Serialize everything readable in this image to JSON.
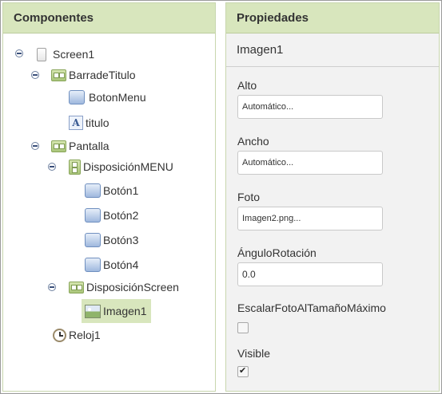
{
  "components": {
    "title": "Componentes",
    "tree": [
      {
        "label": "Screen1",
        "icon": "screen-icon"
      },
      {
        "label": "BarradeTitulo",
        "icon": "horizontal-arrangement-icon"
      },
      {
        "label": "BotonMenu",
        "icon": "button-icon"
      },
      {
        "label": "titulo",
        "icon": "label-icon"
      },
      {
        "label": "Pantalla",
        "icon": "horizontal-arrangement-icon"
      },
      {
        "label": "DisposiciónMENU",
        "icon": "vertical-arrangement-icon"
      },
      {
        "label": "Botón1",
        "icon": "button-icon"
      },
      {
        "label": "Botón2",
        "icon": "button-icon"
      },
      {
        "label": "Botón3",
        "icon": "button-icon"
      },
      {
        "label": "Botón4",
        "icon": "button-icon"
      },
      {
        "label": "DisposiciónScreen",
        "icon": "horizontal-arrangement-icon"
      },
      {
        "label": "Imagen1",
        "icon": "image-icon",
        "selected": true
      },
      {
        "label": "Reloj1",
        "icon": "clock-icon"
      }
    ]
  },
  "properties": {
    "title": "Propiedades",
    "component_name": "Imagen1",
    "alto": {
      "label": "Alto",
      "value": "Automático..."
    },
    "ancho": {
      "label": "Ancho",
      "value": "Automático..."
    },
    "foto": {
      "label": "Foto",
      "value": "Imagen2.png..."
    },
    "angulo": {
      "label": "ÁnguloRotación",
      "value": "0.0"
    },
    "escalar": {
      "label": "EscalarFotoAlTamañoMáximo",
      "checked": false
    },
    "visible": {
      "label": "Visible",
      "checked": true
    }
  },
  "colors": {
    "header_bg": "#d8e6bd",
    "selected_bg": "#d8e6bd",
    "panel_bg": "#f2f2f2"
  }
}
